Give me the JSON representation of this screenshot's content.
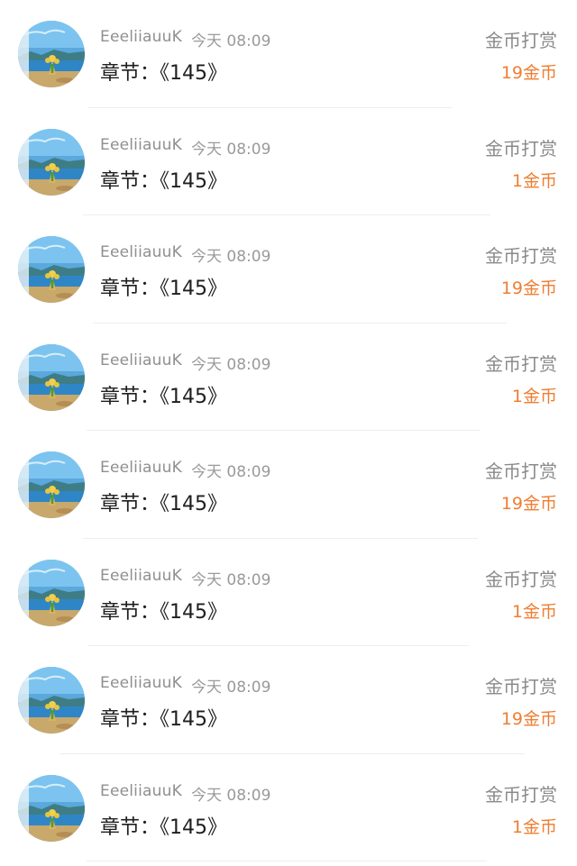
{
  "records": [
    {
      "username": "EeeliiauuK",
      "time": "今天 08:09",
      "chapter": "章节：《145》",
      "type": "金币打赏",
      "amount": "19金币"
    },
    {
      "username": "EeeliiauuK",
      "time": "今天 08:09",
      "chapter": "章节：《145》",
      "type": "金币打赏",
      "amount": "1金币"
    },
    {
      "username": "EeeliiauuK",
      "time": "今天 08:09",
      "chapter": "章节：《145》",
      "type": "金币打赏",
      "amount": "19金币"
    },
    {
      "username": "EeeliiauuK",
      "time": "今天 08:09",
      "chapter": "章节：《145》",
      "type": "金币打赏",
      "amount": "1金币"
    },
    {
      "username": "EeeliiauuK",
      "time": "今天 08:09",
      "chapter": "章节：《145》",
      "type": "金币打赏",
      "amount": "19金币"
    },
    {
      "username": "EeeliiauuK",
      "time": "今天 08:09",
      "chapter": "章节：《145》",
      "type": "金币打赏",
      "amount": "1金币"
    },
    {
      "username": "EeeliiauuK",
      "time": "今天 08:09",
      "chapter": "章节：《145》",
      "type": "金币打赏",
      "amount": "19金币"
    },
    {
      "username": "EeeliiauuK",
      "time": "今天 08:09",
      "chapter": "章节：《145》",
      "type": "金币打赏",
      "amount": "1金币"
    }
  ],
  "colors": {
    "amount": "#ef7e33",
    "username": "#8f8f8f",
    "chapter": "#1e1e1e",
    "type": "#8a8a8a"
  }
}
